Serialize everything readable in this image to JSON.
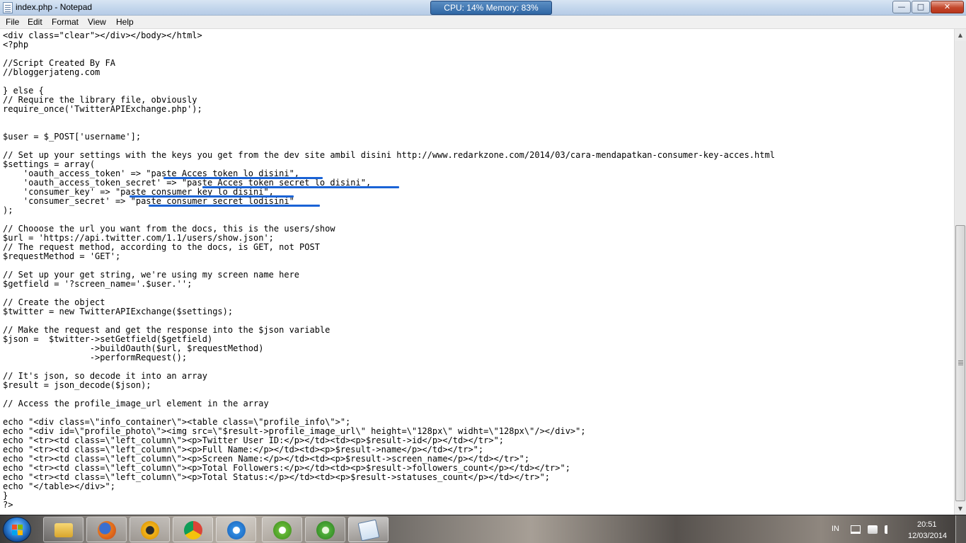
{
  "window": {
    "title": "index.php - Notepad",
    "gadget_text": "CPU: 14%   Memory: 83%",
    "buttons": {
      "minimize": "—",
      "maximize": "□",
      "close": "✕"
    }
  },
  "menu": {
    "file": "File",
    "edit": "Edit",
    "format": "Format",
    "view": "View",
    "help": "Help"
  },
  "editor": {
    "lines": [
      "<div class=\"clear\"></div></body></html>",
      "<?php",
      "",
      "//Script Created By FA",
      "//bloggerjateng.com",
      "",
      "} else {",
      "// Require the library file, obviously",
      "require_once('TwitterAPIExchange.php');",
      "",
      "",
      "$user = $_POST['username'];",
      "",
      "// Set up your settings with the keys you get from the dev site ambil disini http://www.redarkzone.com/2014/03/cara-mendapatkan-consumer-key-acces.html",
      "$settings = array(",
      "    'oauth_access_token' => \"paste Acces token lo disini\",",
      "    'oauth_access_token_secret' => \"paste Acces token secret lo disini\",",
      "    'consumer_key' => \"paste consumer key lo disini\",",
      "    'consumer_secret' => \"paste consumer secret lodisini\"",
      ");",
      "",
      "// Chooose the url you want from the docs, this is the users/show",
      "$url = 'https://api.twitter.com/1.1/users/show.json';",
      "// The request method, according to the docs, is GET, not POST",
      "$requestMethod = 'GET';",
      "",
      "// Set up your get string, we're using my screen name here",
      "$getfield = '?screen_name='.$user.'';",
      "",
      "// Create the object",
      "$twitter = new TwitterAPIExchange($settings);",
      "",
      "// Make the request and get the response into the $json variable",
      "$json =  $twitter->setGetfield($getfield)",
      "                 ->buildOauth($url, $requestMethod)",
      "                 ->performRequest();",
      "",
      "// It's json, so decode it into an array",
      "$result = json_decode($json);",
      "",
      "// Access the profile_image_url element in the array",
      "",
      "echo \"<div class=\\\"info_container\\\"><table class=\\\"profile_info\\\">\";",
      "echo \"<div id=\\\"profile_photo\\\"><img src=\\\"$result->profile_image_url\\\" height=\\\"128px\\\" widht=\\\"128px\\\"/></div>\";",
      "echo \"<tr><td class=\\\"left_column\\\"><p>Twitter User ID:</p></td><td><p>$result->id</p></td></tr>\";",
      "echo \"<tr><td class=\\\"left_column\\\"><p>Full Name:</p></td><td><p>$result->name</p></td></tr>\";",
      "echo \"<tr><td class=\\\"left_column\\\"><p>Screen Name:</p></td><td><p>$result->screen_name</p></td></tr>\";",
      "echo \"<tr><td class=\\\"left_column\\\"><p>Total Followers:</p></td><td><p>$result->followers_count</p></td></tr>\";",
      "echo \"<tr><td class=\\\"left_column\\\"><p>Total Status:</p></td><td><p>$result->statuses_count</p></td></tr>\";",
      "echo \"</table></div>\";",
      "}",
      "?>"
    ]
  },
  "taskbar": {
    "apps": [
      "windows-explorer-icon",
      "firefox-icon",
      "vlc-icon",
      "chrome-icon",
      "safari-icon",
      "utorrent-icon",
      "downloader-icon",
      "notepad-icon"
    ],
    "language": "IN",
    "time": "20:51",
    "date": "12/03/2014"
  },
  "colors": {
    "highlight_underline": "#1a63d6",
    "titlebar": "#c3d6ec",
    "close_button": "#c3472c"
  }
}
